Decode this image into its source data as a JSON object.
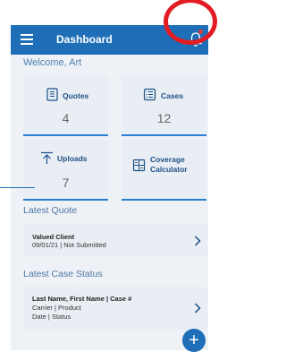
{
  "appbar": {
    "title": "Dashboard"
  },
  "welcome": {
    "text": "Welcome, Art"
  },
  "tiles": [
    {
      "label": "Quotes",
      "count": "4",
      "icon": "quote-doc-icon"
    },
    {
      "label": "Cases",
      "count": "12",
      "icon": "cases-icon"
    },
    {
      "label": "Uploads",
      "count": "7",
      "icon": "upload-arrow-icon"
    },
    {
      "label_line1": "Coverage",
      "label_line2": "Calculator",
      "icon": "calculator-icon"
    }
  ],
  "latest_quote": {
    "title": "Latest Quote",
    "client": "Valued Client",
    "detail": "09/01/21 | Not Submitted"
  },
  "latest_case": {
    "title": "Latest Case Status",
    "line1": "Last Name, First Name | Case #",
    "line2": "Carrier | Product",
    "line3": "Date | Status"
  },
  "fab": {
    "label": "+"
  },
  "colors": {
    "primary": "#1e6fb7",
    "highlight_ring": "#e31b23",
    "notification_dot": "#e53935"
  }
}
